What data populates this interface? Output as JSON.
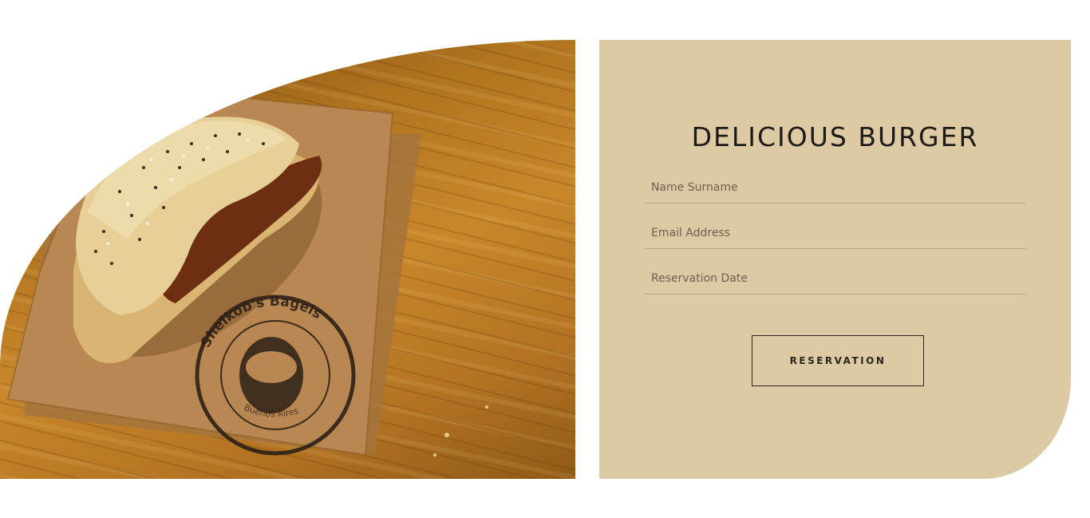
{
  "hero_image": {
    "stamp_text_top": "Sheikob's Bagels",
    "stamp_text_bottom": "Buenos Aires"
  },
  "form": {
    "title": "DELICIOUS BURGER",
    "name_placeholder": "Name Surname",
    "email_placeholder": "Email Address",
    "date_placeholder": "Reservation Date",
    "submit_label": "RESERVATION"
  },
  "colors": {
    "form_background": "#dec9a5",
    "text_dark": "#1d1b17",
    "field_line": "#b8a686"
  }
}
